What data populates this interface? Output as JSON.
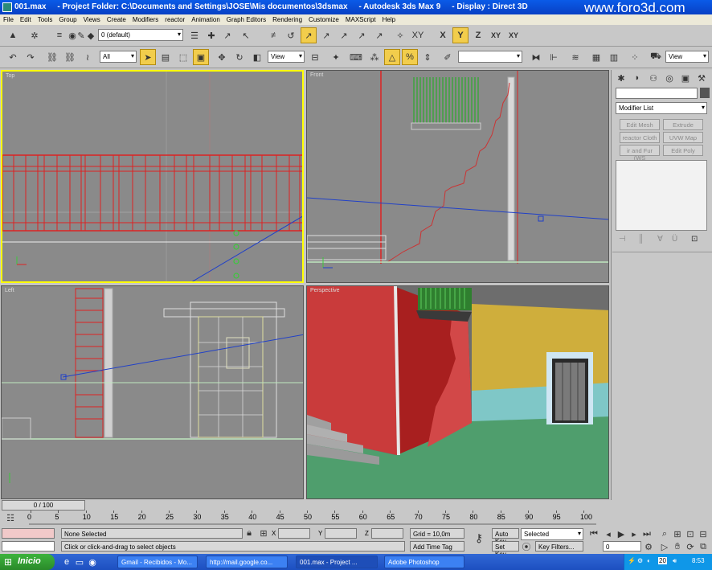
{
  "window": {
    "title": "001.max     - Project Folder: C:\\Documents and Settings\\JOSE\\Mis documentos\\3dsmax     - Autodesk 3ds Max 9     - Display : Direct 3D",
    "watermark": "www.foro3d.com"
  },
  "menu": [
    "File",
    "Edit",
    "Tools",
    "Group",
    "Views",
    "Create",
    "Modifiers",
    "reactor",
    "Animation",
    "Graph Editors",
    "Rendering",
    "Customize",
    "MAXScript",
    "Help"
  ],
  "toolbar": {
    "layer_value": "0 (default)",
    "selection_filter": "All",
    "reference_coord": "View",
    "named_selection": "",
    "render_type": "View"
  },
  "viewports": {
    "top": "Top",
    "front": "Front",
    "left": "Left",
    "perspective": "Perspective"
  },
  "command_panel": {
    "modifier_list": "Modifier List",
    "buttons": [
      "Edit Mesh",
      "Extrude",
      "reactor Cloth",
      "UVW Map",
      "ir and Fur (WS",
      "Edit Poly"
    ]
  },
  "timeline": {
    "slider": "0 / 100",
    "ticks": [
      "0",
      "5",
      "10",
      "15",
      "20",
      "25",
      "30",
      "35",
      "40",
      "45",
      "50",
      "55",
      "60",
      "65",
      "70",
      "75",
      "80",
      "85",
      "90",
      "95",
      "100"
    ]
  },
  "status": {
    "selection": "None Selected",
    "prompt": "Click or click-and-drag to select objects",
    "x_label": "X",
    "y_label": "Y",
    "z_label": "Z",
    "grid": "Grid = 10,0m",
    "add_time_tag": "Add Time Tag",
    "auto_key": "Auto Key",
    "set_key": "Set Key",
    "key_mode": "Selected",
    "key_filters": "Key Filters...",
    "frame": "0"
  },
  "taskbar": {
    "start": "Inicio",
    "tasks": [
      "Gmail - Recibidos - Mo...",
      "http://mail.google.co...",
      "001.max     - Project ...",
      "Adobe Photoshop"
    ],
    "clock": "8:53",
    "tray_count": "20"
  }
}
